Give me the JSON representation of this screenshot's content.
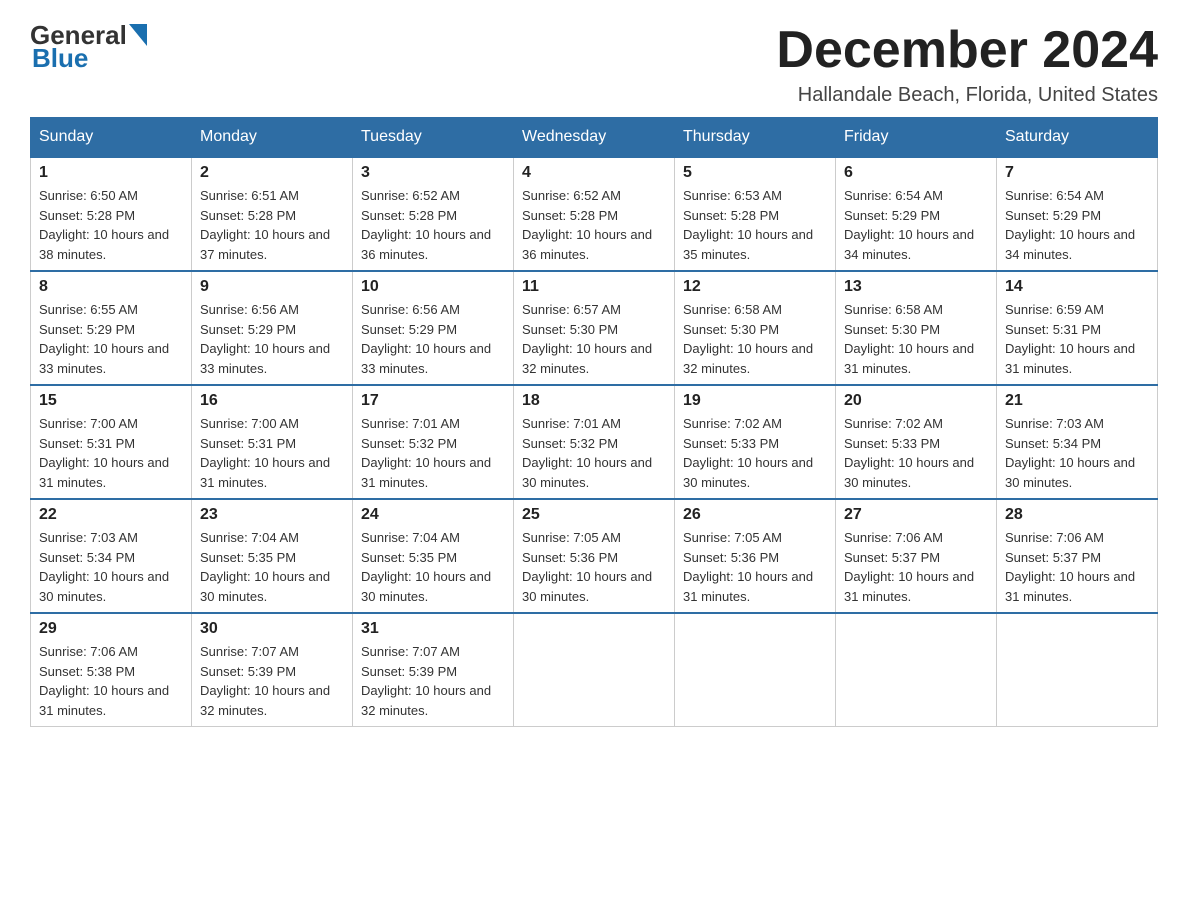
{
  "header": {
    "logo_general": "General",
    "logo_blue": "Blue",
    "month_title": "December 2024",
    "location": "Hallandale Beach, Florida, United States"
  },
  "days_of_week": [
    "Sunday",
    "Monday",
    "Tuesday",
    "Wednesday",
    "Thursday",
    "Friday",
    "Saturday"
  ],
  "weeks": [
    [
      {
        "day": "1",
        "sunrise": "6:50 AM",
        "sunset": "5:28 PM",
        "daylight": "10 hours and 38 minutes."
      },
      {
        "day": "2",
        "sunrise": "6:51 AM",
        "sunset": "5:28 PM",
        "daylight": "10 hours and 37 minutes."
      },
      {
        "day": "3",
        "sunrise": "6:52 AM",
        "sunset": "5:28 PM",
        "daylight": "10 hours and 36 minutes."
      },
      {
        "day": "4",
        "sunrise": "6:52 AM",
        "sunset": "5:28 PM",
        "daylight": "10 hours and 36 minutes."
      },
      {
        "day": "5",
        "sunrise": "6:53 AM",
        "sunset": "5:28 PM",
        "daylight": "10 hours and 35 minutes."
      },
      {
        "day": "6",
        "sunrise": "6:54 AM",
        "sunset": "5:29 PM",
        "daylight": "10 hours and 34 minutes."
      },
      {
        "day": "7",
        "sunrise": "6:54 AM",
        "sunset": "5:29 PM",
        "daylight": "10 hours and 34 minutes."
      }
    ],
    [
      {
        "day": "8",
        "sunrise": "6:55 AM",
        "sunset": "5:29 PM",
        "daylight": "10 hours and 33 minutes."
      },
      {
        "day": "9",
        "sunrise": "6:56 AM",
        "sunset": "5:29 PM",
        "daylight": "10 hours and 33 minutes."
      },
      {
        "day": "10",
        "sunrise": "6:56 AM",
        "sunset": "5:29 PM",
        "daylight": "10 hours and 33 minutes."
      },
      {
        "day": "11",
        "sunrise": "6:57 AM",
        "sunset": "5:30 PM",
        "daylight": "10 hours and 32 minutes."
      },
      {
        "day": "12",
        "sunrise": "6:58 AM",
        "sunset": "5:30 PM",
        "daylight": "10 hours and 32 minutes."
      },
      {
        "day": "13",
        "sunrise": "6:58 AM",
        "sunset": "5:30 PM",
        "daylight": "10 hours and 31 minutes."
      },
      {
        "day": "14",
        "sunrise": "6:59 AM",
        "sunset": "5:31 PM",
        "daylight": "10 hours and 31 minutes."
      }
    ],
    [
      {
        "day": "15",
        "sunrise": "7:00 AM",
        "sunset": "5:31 PM",
        "daylight": "10 hours and 31 minutes."
      },
      {
        "day": "16",
        "sunrise": "7:00 AM",
        "sunset": "5:31 PM",
        "daylight": "10 hours and 31 minutes."
      },
      {
        "day": "17",
        "sunrise": "7:01 AM",
        "sunset": "5:32 PM",
        "daylight": "10 hours and 31 minutes."
      },
      {
        "day": "18",
        "sunrise": "7:01 AM",
        "sunset": "5:32 PM",
        "daylight": "10 hours and 30 minutes."
      },
      {
        "day": "19",
        "sunrise": "7:02 AM",
        "sunset": "5:33 PM",
        "daylight": "10 hours and 30 minutes."
      },
      {
        "day": "20",
        "sunrise": "7:02 AM",
        "sunset": "5:33 PM",
        "daylight": "10 hours and 30 minutes."
      },
      {
        "day": "21",
        "sunrise": "7:03 AM",
        "sunset": "5:34 PM",
        "daylight": "10 hours and 30 minutes."
      }
    ],
    [
      {
        "day": "22",
        "sunrise": "7:03 AM",
        "sunset": "5:34 PM",
        "daylight": "10 hours and 30 minutes."
      },
      {
        "day": "23",
        "sunrise": "7:04 AM",
        "sunset": "5:35 PM",
        "daylight": "10 hours and 30 minutes."
      },
      {
        "day": "24",
        "sunrise": "7:04 AM",
        "sunset": "5:35 PM",
        "daylight": "10 hours and 30 minutes."
      },
      {
        "day": "25",
        "sunrise": "7:05 AM",
        "sunset": "5:36 PM",
        "daylight": "10 hours and 30 minutes."
      },
      {
        "day": "26",
        "sunrise": "7:05 AM",
        "sunset": "5:36 PM",
        "daylight": "10 hours and 31 minutes."
      },
      {
        "day": "27",
        "sunrise": "7:06 AM",
        "sunset": "5:37 PM",
        "daylight": "10 hours and 31 minutes."
      },
      {
        "day": "28",
        "sunrise": "7:06 AM",
        "sunset": "5:37 PM",
        "daylight": "10 hours and 31 minutes."
      }
    ],
    [
      {
        "day": "29",
        "sunrise": "7:06 AM",
        "sunset": "5:38 PM",
        "daylight": "10 hours and 31 minutes."
      },
      {
        "day": "30",
        "sunrise": "7:07 AM",
        "sunset": "5:39 PM",
        "daylight": "10 hours and 32 minutes."
      },
      {
        "day": "31",
        "sunrise": "7:07 AM",
        "sunset": "5:39 PM",
        "daylight": "10 hours and 32 minutes."
      },
      null,
      null,
      null,
      null
    ]
  ],
  "labels": {
    "sunrise": "Sunrise: ",
    "sunset": "Sunset: ",
    "daylight": "Daylight: "
  }
}
